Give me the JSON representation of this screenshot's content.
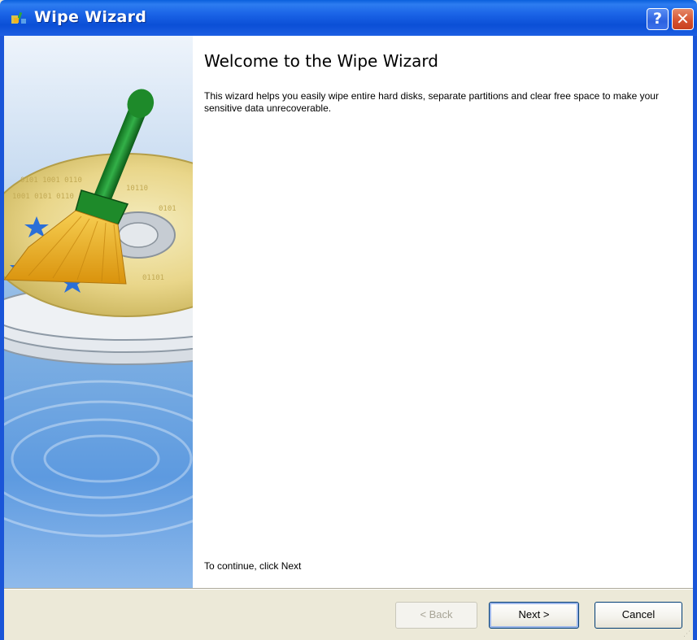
{
  "window": {
    "title": "Wipe Wizard",
    "help_label": "?",
    "close_label": "✕"
  },
  "content": {
    "heading": "Welcome to the Wipe Wizard",
    "description": "This wizard helps you easily wipe entire hard disks, separate partitions and clear free space to make your sensitive data unrecoverable.",
    "footer_hint": "To continue, click Next"
  },
  "buttons": {
    "back_label": "< Back",
    "next_label": "Next >",
    "cancel_label": "Cancel",
    "back_enabled": false
  },
  "colors": {
    "titlebar_blue": "#0b4fd6",
    "panel_bg": "#ece9d8",
    "broom_green": "#1e8a2a",
    "broom_bristles": "#f2b21c"
  },
  "icons": {
    "app": "broom-app-icon",
    "side_art": "broom-over-disks-illustration"
  }
}
